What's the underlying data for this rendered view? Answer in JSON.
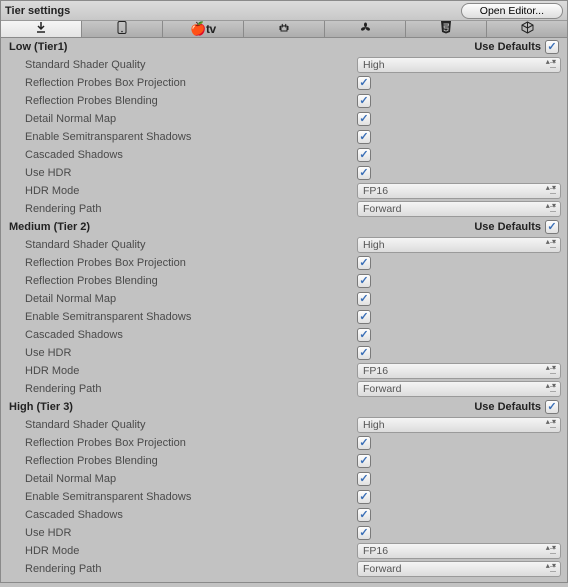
{
  "header": {
    "title": "Tier settings",
    "open_editor": "Open Editor..."
  },
  "tabs": [
    {
      "name": "download",
      "glyph": "⬇"
    },
    {
      "name": "phone",
      "glyph": "▢"
    },
    {
      "name": "appletv",
      "glyph": "tv"
    },
    {
      "name": "android",
      "glyph": "⋮⋮"
    },
    {
      "name": "fan",
      "glyph": "✲"
    },
    {
      "name": "html5",
      "glyph": "⬢"
    },
    {
      "name": "cube",
      "glyph": "◫"
    }
  ],
  "use_defaults_label": "Use Defaults",
  "tiers": [
    {
      "title": "Low (Tier1)",
      "use_defaults": true,
      "rows": [
        {
          "label": "Standard Shader Quality",
          "type": "select",
          "value": "High"
        },
        {
          "label": "Reflection Probes Box Projection",
          "type": "check",
          "value": true
        },
        {
          "label": "Reflection Probes Blending",
          "type": "check",
          "value": true
        },
        {
          "label": "Detail Normal Map",
          "type": "check",
          "value": true
        },
        {
          "label": "Enable Semitransparent Shadows",
          "type": "check",
          "value": true
        },
        {
          "label": "Cascaded Shadows",
          "type": "check",
          "value": true
        },
        {
          "label": "Use HDR",
          "type": "check",
          "value": true
        },
        {
          "label": "HDR Mode",
          "type": "select",
          "value": "FP16"
        },
        {
          "label": "Rendering Path",
          "type": "select",
          "value": "Forward"
        }
      ]
    },
    {
      "title": "Medium (Tier 2)",
      "use_defaults": true,
      "rows": [
        {
          "label": "Standard Shader Quality",
          "type": "select",
          "value": "High"
        },
        {
          "label": "Reflection Probes Box Projection",
          "type": "check",
          "value": true
        },
        {
          "label": "Reflection Probes Blending",
          "type": "check",
          "value": true
        },
        {
          "label": "Detail Normal Map",
          "type": "check",
          "value": true
        },
        {
          "label": "Enable Semitransparent Shadows",
          "type": "check",
          "value": true
        },
        {
          "label": "Cascaded Shadows",
          "type": "check",
          "value": true
        },
        {
          "label": "Use HDR",
          "type": "check",
          "value": true
        },
        {
          "label": "HDR Mode",
          "type": "select",
          "value": "FP16"
        },
        {
          "label": "Rendering Path",
          "type": "select",
          "value": "Forward"
        }
      ]
    },
    {
      "title": "High (Tier 3)",
      "use_defaults": true,
      "rows": [
        {
          "label": "Standard Shader Quality",
          "type": "select",
          "value": "High"
        },
        {
          "label": "Reflection Probes Box Projection",
          "type": "check",
          "value": true
        },
        {
          "label": "Reflection Probes Blending",
          "type": "check",
          "value": true
        },
        {
          "label": "Detail Normal Map",
          "type": "check",
          "value": true
        },
        {
          "label": "Enable Semitransparent Shadows",
          "type": "check",
          "value": true
        },
        {
          "label": "Cascaded Shadows",
          "type": "check",
          "value": true
        },
        {
          "label": "Use HDR",
          "type": "check",
          "value": true
        },
        {
          "label": "HDR Mode",
          "type": "select",
          "value": "FP16"
        },
        {
          "label": "Rendering Path",
          "type": "select",
          "value": "Forward"
        }
      ]
    }
  ]
}
